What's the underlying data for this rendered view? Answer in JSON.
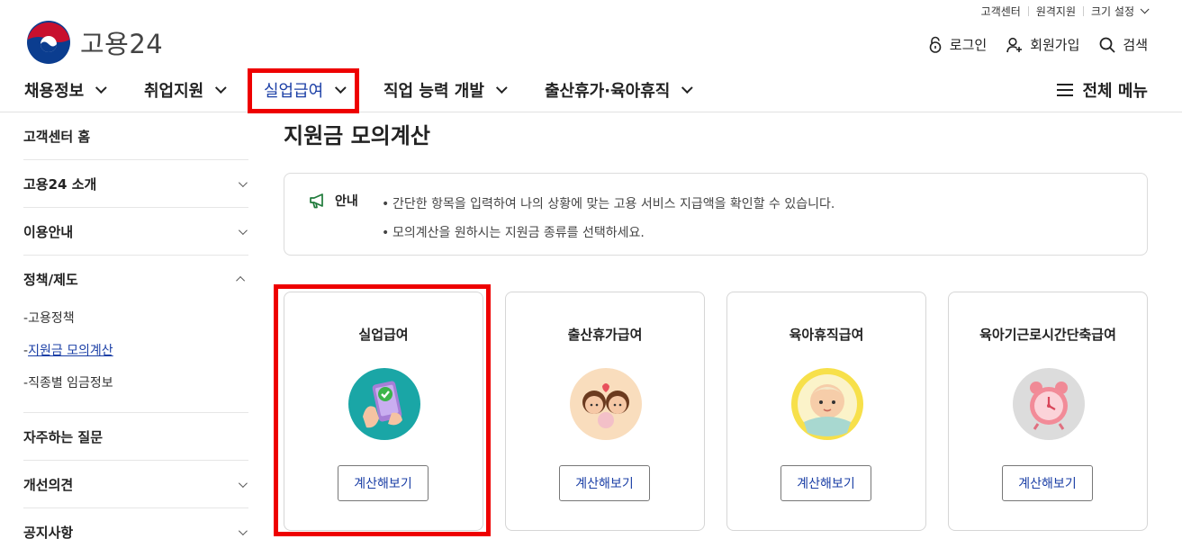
{
  "util": {
    "customer_center": "고객센터",
    "remote_support": "원격지원",
    "font_size": "크기 설정"
  },
  "logo": {
    "text": "고용24"
  },
  "account": {
    "login": "로그인",
    "signup": "회원가입",
    "search": "검색"
  },
  "gnb": {
    "items": [
      {
        "label": "채용정보"
      },
      {
        "label": "취업지원"
      },
      {
        "label": "실업급여"
      },
      {
        "label": "직업 능력 개발"
      },
      {
        "label": "출산휴가·육아휴직"
      }
    ],
    "all_menu": "전체 메뉴"
  },
  "side": {
    "home": "고객센터 홈",
    "sections": [
      {
        "label": "고용24 소개"
      },
      {
        "label": "이용안내"
      },
      {
        "label": "정책/제도"
      },
      {
        "label": "자주하는 질문"
      },
      {
        "label": "개선의견"
      },
      {
        "label": "공지사항"
      }
    ],
    "sub_items": [
      {
        "label": "고용정책"
      },
      {
        "label": "지원금 모의계산"
      },
      {
        "label": "직종별 임금정보"
      }
    ],
    "sub_prefix": "-"
  },
  "main": {
    "title": "지원금 모의계산",
    "notice_label": "안내",
    "notices": [
      "간단한 항목을 입력하여 나의 상황에 맞는 고용 서비스 지급액을 확인할 수 있습니다.",
      "모의계산을 원하시는 지원금 종류를 선택하세요."
    ],
    "cards": [
      {
        "title": "실업급여",
        "icon": "phone-check-icon",
        "button": "계산해보기"
      },
      {
        "title": "출산휴가급여",
        "icon": "family-icon",
        "button": "계산해보기"
      },
      {
        "title": "육아휴직급여",
        "icon": "baby-icon",
        "button": "계산해보기"
      },
      {
        "title": "육아기근로시간단축급여",
        "icon": "alarm-clock-icon",
        "button": "계산해보기"
      }
    ]
  },
  "colors": {
    "accent": "#1b3fa6",
    "highlight": "#ee0000"
  }
}
